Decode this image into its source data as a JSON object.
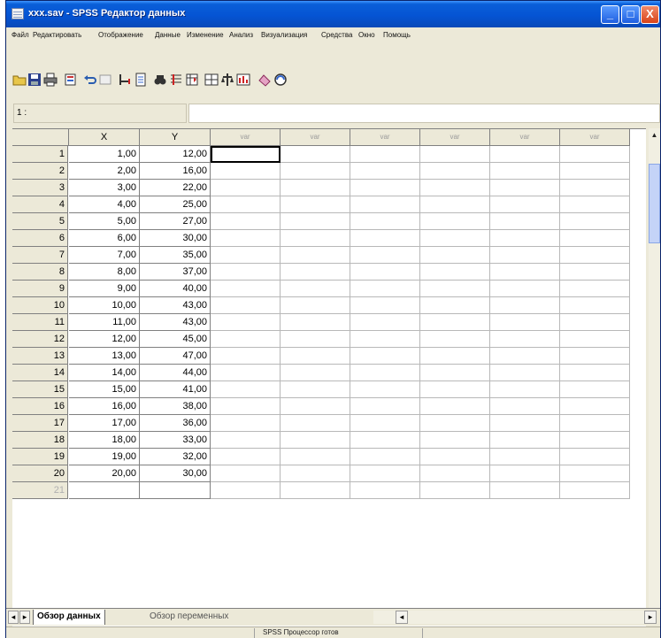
{
  "window": {
    "title": "xxx.sav - SPSS Редактор данных",
    "minimize_glyph": "_",
    "maximize_glyph": "□",
    "close_glyph": "X"
  },
  "menu": [
    "Файл",
    "Редактировать",
    "Отображение",
    "Данные",
    "Изменение",
    "Анализ",
    "Визуализация",
    "Средства",
    "Окно",
    "Помощь"
  ],
  "toolbar": {
    "icons": [
      "open-icon",
      "save-icon",
      "print-icon",
      "dialog-recall-icon",
      "undo-icon",
      "redo-icon",
      "goto-case-icon",
      "variables-icon",
      "find-icon",
      "insert-case-icon",
      "insert-variable-icon",
      "split-file-icon",
      "weight-cases-icon",
      "select-cases-icon",
      "value-labels-icon",
      "use-sets-icon"
    ]
  },
  "cell_editor": {
    "reference": "1 :",
    "value": ""
  },
  "grid": {
    "columns": [
      "X",
      "Y"
    ],
    "var_headers": [
      "var",
      "var",
      "var",
      "var",
      "var",
      "var"
    ],
    "rows": [
      {
        "n": "1",
        "x": "1,00",
        "y": "12,00"
      },
      {
        "n": "2",
        "x": "2,00",
        "y": "16,00"
      },
      {
        "n": "3",
        "x": "3,00",
        "y": "22,00"
      },
      {
        "n": "4",
        "x": "4,00",
        "y": "25,00"
      },
      {
        "n": "5",
        "x": "5,00",
        "y": "27,00"
      },
      {
        "n": "6",
        "x": "6,00",
        "y": "30,00"
      },
      {
        "n": "7",
        "x": "7,00",
        "y": "35,00"
      },
      {
        "n": "8",
        "x": "8,00",
        "y": "37,00"
      },
      {
        "n": "9",
        "x": "9,00",
        "y": "40,00"
      },
      {
        "n": "10",
        "x": "10,00",
        "y": "43,00"
      },
      {
        "n": "11",
        "x": "11,00",
        "y": "43,00"
      },
      {
        "n": "12",
        "x": "12,00",
        "y": "45,00"
      },
      {
        "n": "13",
        "x": "13,00",
        "y": "47,00"
      },
      {
        "n": "14",
        "x": "14,00",
        "y": "44,00"
      },
      {
        "n": "15",
        "x": "15,00",
        "y": "41,00"
      },
      {
        "n": "16",
        "x": "16,00",
        "y": "38,00"
      },
      {
        "n": "17",
        "x": "17,00",
        "y": "36,00"
      },
      {
        "n": "18",
        "x": "18,00",
        "y": "33,00"
      },
      {
        "n": "19",
        "x": "19,00",
        "y": "32,00"
      },
      {
        "n": "20",
        "x": "20,00",
        "y": "30,00"
      },
      {
        "n": "21",
        "x": "",
        "y": ""
      }
    ]
  },
  "tabs": {
    "data_view": "Обзор данных",
    "variable_view": "Обзор переменных"
  },
  "status": {
    "processor": "SPSS Процессор готов"
  }
}
